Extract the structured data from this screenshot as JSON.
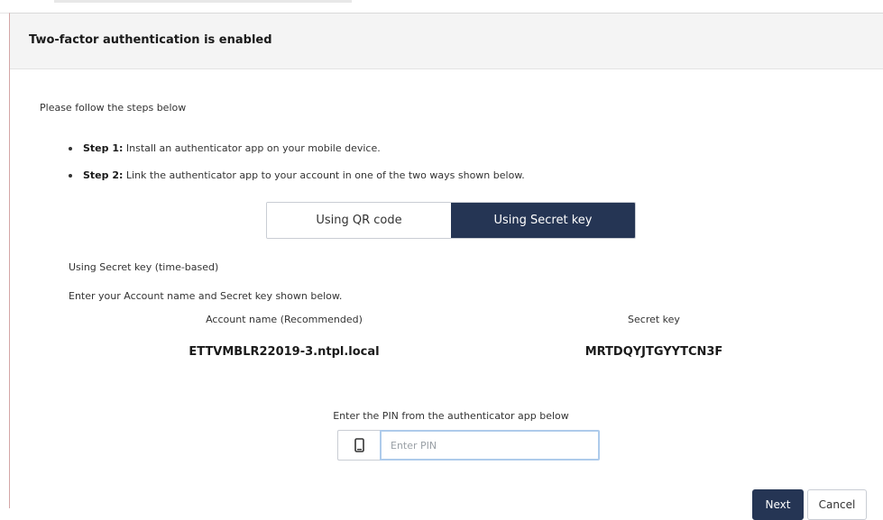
{
  "dialog": {
    "title": "Two-factor authentication is enabled",
    "intro": "Please follow the steps below",
    "steps": [
      {
        "label": "Step 1:",
        "text": " Install an authenticator app on your mobile device."
      },
      {
        "label": "Step 2:",
        "text": " Link the authenticator app to your account in one of the two ways shown below."
      }
    ],
    "tabs": [
      {
        "label": "Using QR code",
        "active": false
      },
      {
        "label": "Using Secret key",
        "active": true
      }
    ],
    "secret_section": {
      "heading": "Using Secret key (time-based)",
      "instruction": "Enter your Account name and Secret key shown below.",
      "account_label": "Account name (Recommended)",
      "account_value": "ETTVMBLR22019-3.ntpl.local",
      "secret_label": "Secret key",
      "secret_value": "MRTDQYJTGYYTCN3F"
    },
    "pin": {
      "label": "Enter the PIN from the authenticator app below",
      "placeholder": "Enter PIN",
      "value": "",
      "icon": "mobile-phone-icon"
    },
    "buttons": {
      "next": "Next",
      "cancel": "Cancel"
    }
  },
  "colors": {
    "primary": "#253554",
    "header_bg": "#f4f4f4",
    "input_focus_border": "#aecbeb"
  }
}
